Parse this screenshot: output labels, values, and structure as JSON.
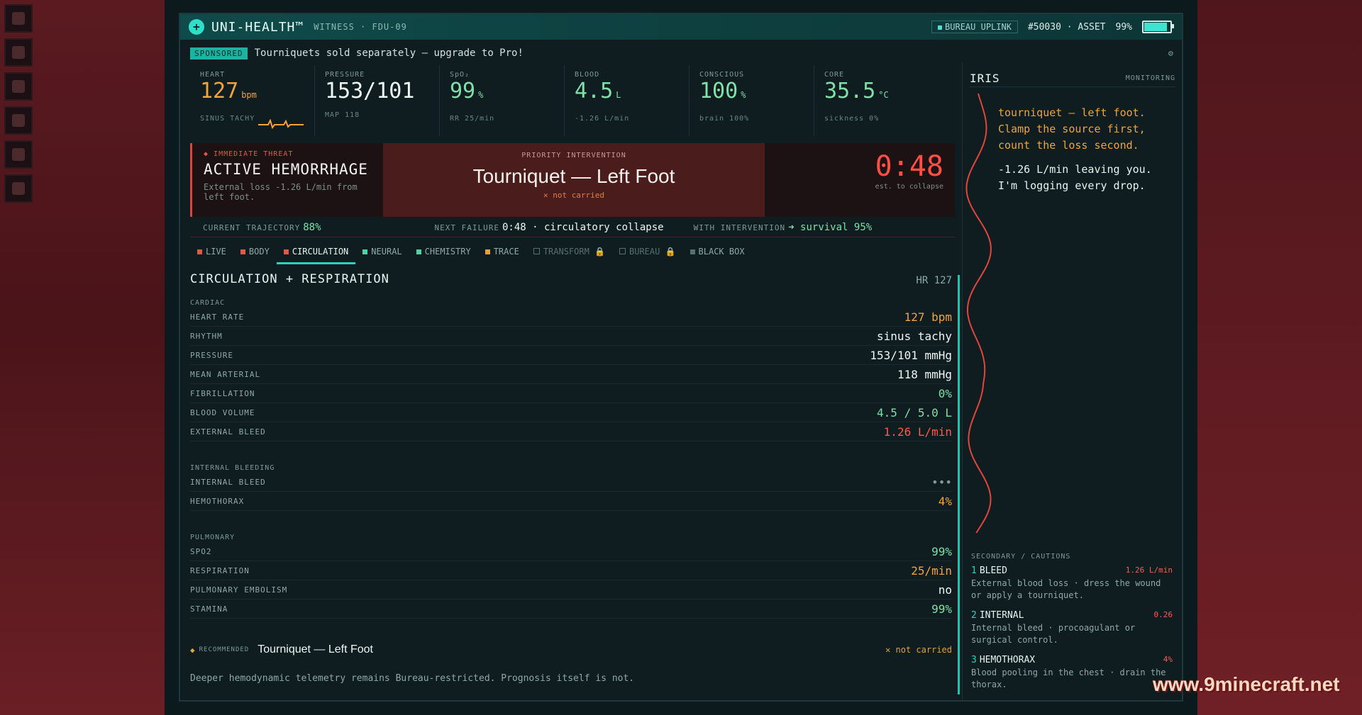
{
  "app": {
    "brand": "UNI-HEALTH™",
    "witness": "WITNESS · FDU-09",
    "uplink": "BUREAU UPLINK",
    "asset": "#50030 · ASSET",
    "battery_pct": "99%",
    "battery_fill": 0.99,
    "accent": "#2ad3c0"
  },
  "sponsor": {
    "tag": "SPONSORED",
    "text": "Tourniquets sold separately — upgrade to Pro!",
    "gear": "⚙"
  },
  "vitals": [
    {
      "label": "HEART",
      "value": "127",
      "unit": "bpm",
      "sub": "SINUS TACHY",
      "color": "#f2a33c"
    },
    {
      "label": "PRESSURE",
      "value": "153/101",
      "unit": "",
      "sub": "MAP 118",
      "color": "#eef6f4"
    },
    {
      "label": "SpO₂",
      "value": "99",
      "unit": "%",
      "sub": "RR 25/min",
      "color": "#7fe0a8"
    },
    {
      "label": "BLOOD",
      "value": "4.5",
      "unit": "L",
      "sub": "-1.26 L/min",
      "color": "#7fe0a8"
    },
    {
      "label": "CONSCIOUS",
      "value": "100",
      "unit": "%",
      "sub": "brain 100%",
      "color": "#7fe0a8"
    },
    {
      "label": "CORE",
      "value": "35.5",
      "unit": "°C",
      "sub": "sickness 0%",
      "color": "#7fe0a8"
    }
  ],
  "threat": {
    "label": "IMMEDIATE THREAT",
    "title": "ACTIVE HEMORRHAGE",
    "desc": "External loss -1.26 L/min from left foot.",
    "priority_label": "PRIORITY INTERVENTION",
    "priority": "Tourniquet — Left Foot",
    "not_carried": "✕ not carried",
    "clock": "0:48",
    "clock_sub": "est. to collapse"
  },
  "trajectory": {
    "current_label": "CURRENT TRAJECTORY",
    "current_value": "88%",
    "next_label": "NEXT FAILURE",
    "next_value": "0:48 · circulatory collapse",
    "with_label": "WITH INTERVENTION",
    "with_value": "➜ survival 95%"
  },
  "tabs": [
    {
      "label": "LIVE",
      "color": "#e2574c",
      "state": "normal"
    },
    {
      "label": "BODY",
      "color": "#e2574c",
      "state": "normal"
    },
    {
      "label": "CIRCULATION",
      "color": "#e2574c",
      "state": "active"
    },
    {
      "label": "NEURAL",
      "color": "#4fd1a0",
      "state": "normal"
    },
    {
      "label": "CHEMISTRY",
      "color": "#4fd1a0",
      "state": "normal"
    },
    {
      "label": "TRACE",
      "color": "#e2a23c",
      "state": "normal"
    },
    {
      "label": "TRANSFORM 🔒",
      "color": "",
      "state": "locked"
    },
    {
      "label": "BUREAU 🔒",
      "color": "",
      "state": "locked"
    },
    {
      "label": "BLACK BOX",
      "color": "#55706d",
      "state": "normal"
    }
  ],
  "panel": {
    "title": "CIRCULATION + RESPIRATION",
    "hr": "HR 127",
    "sections": [
      {
        "title": "CARDIAC",
        "rows": [
          {
            "k": "HEART RATE",
            "v": "127 bpm",
            "color": "#f2a33c"
          },
          {
            "k": "RHYTHM",
            "v": "sinus tachy",
            "color": "#eef6f4"
          },
          {
            "k": "PRESSURE",
            "v": "153/101 mmHg",
            "color": "#eef6f4"
          },
          {
            "k": "MEAN ARTERIAL",
            "v": "118 mmHg",
            "color": "#eef6f4"
          },
          {
            "k": "FIBRILLATION",
            "v": "0%",
            "color": "#7fe0a8"
          },
          {
            "k": "BLOOD VOLUME",
            "v": "4.5 / 5.0 L",
            "color": "#7fe0a8"
          },
          {
            "k": "EXTERNAL BLEED",
            "v": "1.26 L/min",
            "color": "#ff5a4f"
          }
        ]
      },
      {
        "title": "INTERNAL BLEEDING",
        "rows": [
          {
            "k": "INTERNAL BLEED",
            "v": "•••",
            "color": "#7d9a97"
          },
          {
            "k": "HEMOTHORAX",
            "v": "4%",
            "color": "#f2a33c"
          }
        ]
      },
      {
        "title": "PULMONARY",
        "rows": [
          {
            "k": "SPO2",
            "v": "99%",
            "color": "#7fe0a8"
          },
          {
            "k": "RESPIRATION",
            "v": "25/min",
            "color": "#f2a33c"
          },
          {
            "k": "PULMONARY EMBOLISM",
            "v": "no",
            "color": "#eef6f4"
          },
          {
            "k": "STAMINA",
            "v": "99%",
            "color": "#7fe0a8"
          }
        ]
      }
    ],
    "recommended_label": "RECOMMENDED",
    "recommended": "Tourniquet — Left Foot",
    "recommended_status": "✕ not carried",
    "note": "Deeper hemodynamic telemetry remains Bureau-restricted. Prognosis itself is not."
  },
  "iris": {
    "name": "IRIS",
    "status": "MONITORING",
    "message1": "tourniquet — left foot. Clamp the source first, count the loss second.",
    "message2": "-1.26 L/min leaving you. I'm logging every drop.",
    "secondary_label": "SECONDARY / CAUTIONS",
    "cautions": [
      {
        "num": "1",
        "title": "BLEED",
        "value": "1.26 L/min",
        "desc": "External blood loss · dress the wound or apply a tourniquet."
      },
      {
        "num": "2",
        "title": "INTERNAL",
        "value": "0.26",
        "desc": "Internal bleed · procoagulant or surgical control."
      },
      {
        "num": "3",
        "title": "HEMOTHORAX",
        "value": "4%",
        "desc": "Blood pooling in the chest · drain the thorax."
      }
    ]
  },
  "watermark": "www.9minecraft.net"
}
